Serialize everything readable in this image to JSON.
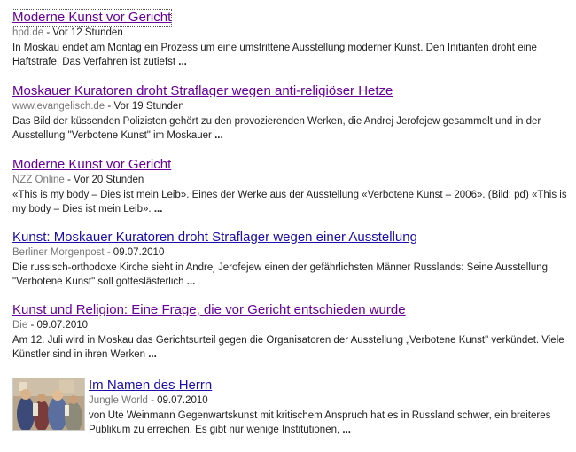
{
  "results": [
    {
      "title": "Moderne Kunst vor Gericht",
      "source": "hpd.de",
      "time": "Vor 12 Stunden",
      "snippet": "In Moskau endet am Montag ein Prozess um eine umstrittene Ausstellung moderner Kunst. Den Initianten droht eine Haftstrafe. Das Verfahren ist zutiefst",
      "ellipsis": "..."
    },
    {
      "title": "Moskauer Kuratoren droht Straflager wegen anti-religiöser Hetze",
      "source": "www.evangelisch.de",
      "time": "Vor 19 Stunden",
      "snippet": "Das Bild der küssenden Polizisten gehört zu den provozierenden Werken, die Andrej Jerofejew gesammelt und in der Ausstellung \"Verbotene Kunst\" im Moskauer",
      "ellipsis": "..."
    },
    {
      "title": "Moderne Kunst vor Gericht",
      "source": "NZZ Online",
      "time": "Vor 20 Stunden",
      "snippet": "«This is my body – Dies ist mein Leib». Eines der Werke aus der Ausstellung «Verbotene Kunst – 2006». (Bild: pd) «This is my body – Dies ist mein Leib».",
      "ellipsis": "..."
    },
    {
      "title": "Kunst: Moskauer Kuratoren droht Straflager wegen einer Ausstellung",
      "source": "Berliner Morgenpost",
      "time": "09.07.2010",
      "snippet": "Die russisch-orthodoxe Kirche sieht in Andrej Jerofejew einen der gefährlichsten Männer Russlands: Seine Ausstellung \"Verbotene Kunst\" soll gotteslästerlich",
      "ellipsis": "..."
    },
    {
      "title": "Kunst und Religion: Eine Frage, die vor Gericht entschieden wurde",
      "source": "Die",
      "time": "09.07.2010",
      "snippet": "Am 12. Juli wird in Moskau das Gerichtsurteil gegen die Organisatoren der Ausstellung „Verbotene Kunst\" verkündet. Viele Künstler sind in ihren Werken",
      "ellipsis": "..."
    },
    {
      "title": "Im Namen des Herrn",
      "source": "Jungle World",
      "time": "09.07.2010",
      "snippet": "von Ute Weinmann Gegenwartskunst mit kritischem Anspruch hat es in Russland schwer, ein breiteres Publikum zu erreichen. Es gibt nur wenige Institutionen,",
      "ellipsis": "..."
    }
  ],
  "separator": " - ",
  "colors": {
    "visited_link": "#660099",
    "unvisited_link": "#1a0dab",
    "source_text": "#777777",
    "body_text": "#222222"
  }
}
